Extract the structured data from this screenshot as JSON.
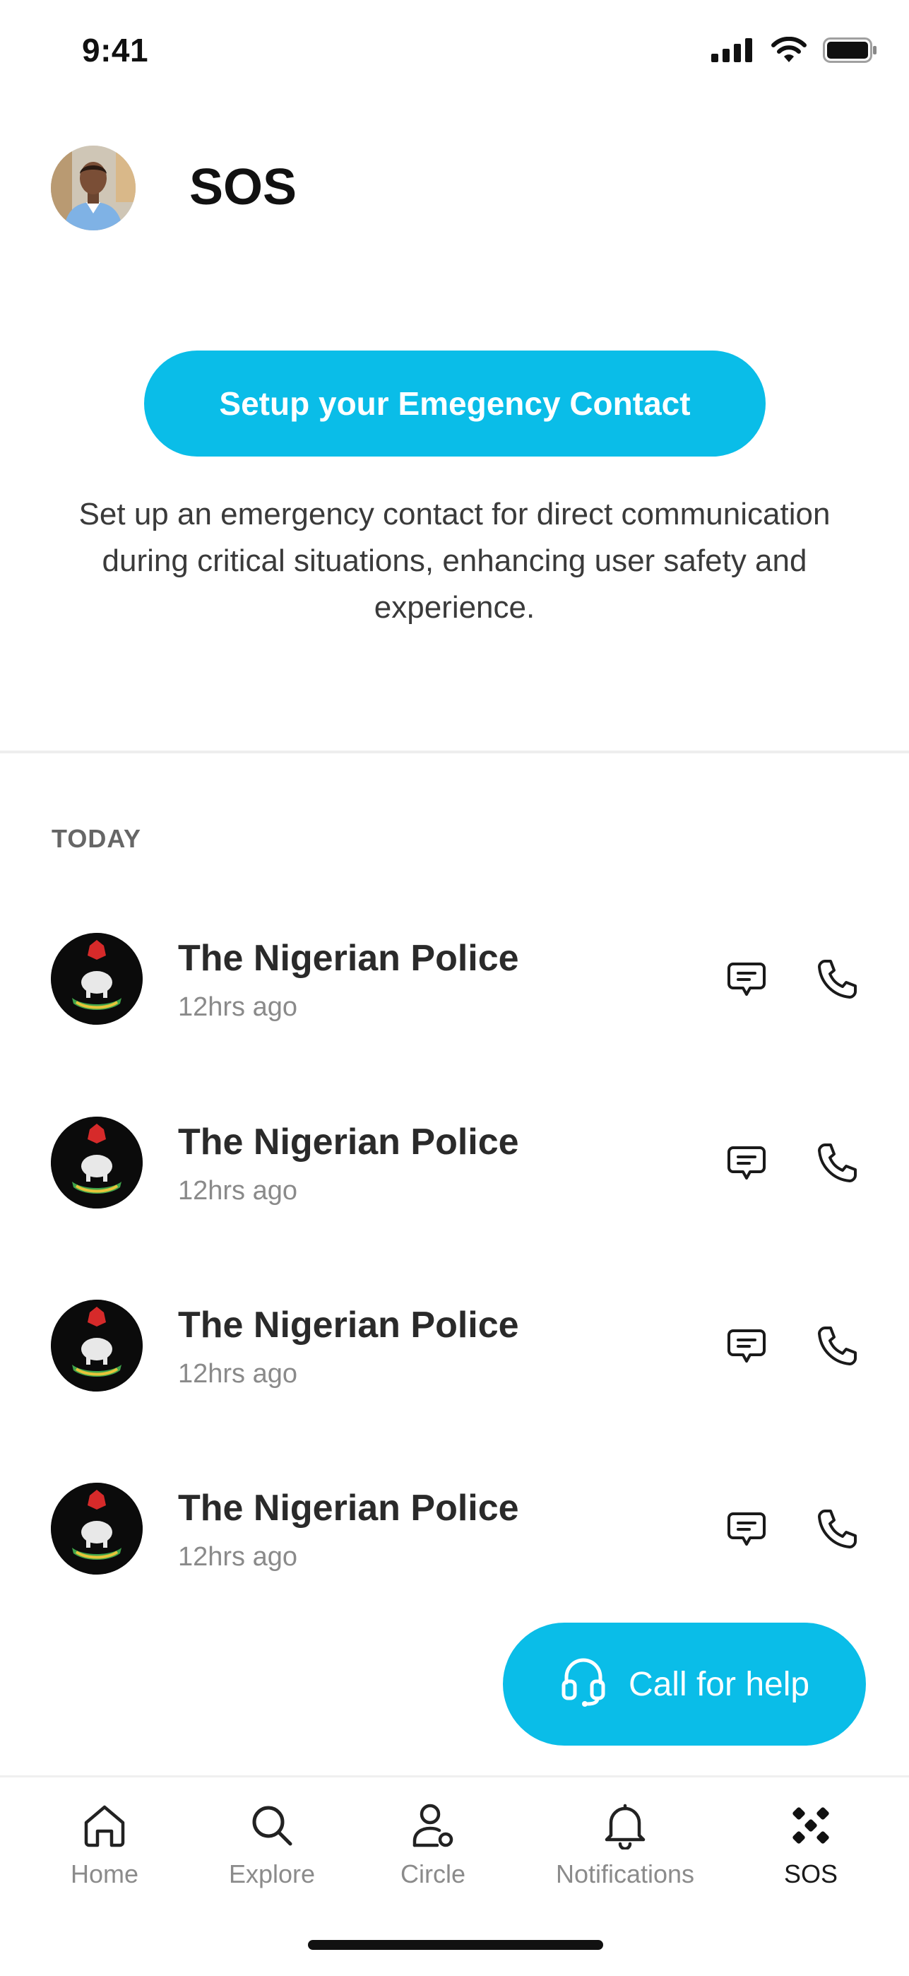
{
  "status_bar": {
    "time": "9:41",
    "icons": [
      "signal-icon",
      "wifi-icon",
      "battery-icon"
    ]
  },
  "header": {
    "title": "SOS",
    "avatar": "user-avatar"
  },
  "setup": {
    "button_label": "Setup your Emegency Contact",
    "description": "Set up an emergency contact for direct communication during critical situations, enhancing user safety and experience."
  },
  "section": {
    "label": "TODAY"
  },
  "contacts": [
    {
      "name": "The Nigerian Police",
      "time": "12hrs ago"
    },
    {
      "name": "The Nigerian Police",
      "time": "12hrs ago"
    },
    {
      "name": "The Nigerian Police",
      "time": "12hrs ago"
    },
    {
      "name": "The Nigerian Police",
      "time": "12hrs ago"
    }
  ],
  "fab": {
    "label": "Call for help",
    "icon": "headset-icon"
  },
  "tabs": [
    {
      "label": "Home",
      "icon": "home-icon"
    },
    {
      "label": "Explore",
      "icon": "search-icon"
    },
    {
      "label": "Circle",
      "icon": "circle-user-icon"
    },
    {
      "label": "Notifications",
      "icon": "bell-icon"
    },
    {
      "label": "SOS",
      "icon": "sos-icon",
      "active": true
    }
  ],
  "colors": {
    "accent": "#0abde8",
    "text": "#1f1f1f",
    "muted": "#8a8a8a"
  }
}
